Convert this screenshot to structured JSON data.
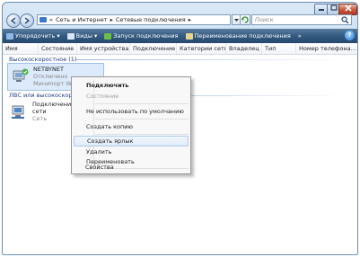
{
  "address": {
    "segments": [
      "«",
      "Сеть и Интернет",
      "▸",
      "Сетевые подключения",
      "▸"
    ],
    "search_placeholder": "Поиск"
  },
  "toolbar": {
    "organize": "Упорядочить",
    "views": "Виды",
    "start": "Запуск подключения",
    "rename": "Переименование подключения",
    "more": "»"
  },
  "columns": [
    "Имя",
    "Состояние",
    "Имя устройства",
    "Подключение",
    "Категории сети",
    "Владелец",
    "Тип",
    "Номер телефона..."
  ],
  "groups": {
    "g1": "Высокоскоростное (1)",
    "g2": "ЛВС или высокоскоростн"
  },
  "items": {
    "i1": {
      "name": "NETBYNET",
      "status": "Отключено",
      "device": "Минипорт WAN"
    },
    "i2": {
      "name": "Подключение п",
      "line2": "сети",
      "status": "Сеть"
    }
  },
  "menu": {
    "connect": "Подключить",
    "status": "Состояние",
    "set_default": "Не использовать по умолчанию",
    "copy": "Создать копию",
    "shortcut": "Создать ярлык",
    "delete": "Удалить",
    "rename": "Переименовать",
    "properties": "Свойства"
  },
  "colors": {
    "toolbar": "#335a80",
    "group_text": "#1e3c8c",
    "selection": "#dceafb",
    "menu_hover": "#e1ecfa"
  },
  "icons": [
    "back-arrow-icon",
    "forward-arrow-icon",
    "folder-icon",
    "refresh-icon",
    "search-icon",
    "organize-icon",
    "views-icon",
    "connect-icon",
    "rename-icon",
    "help-icon",
    "network-connection-icon"
  ]
}
